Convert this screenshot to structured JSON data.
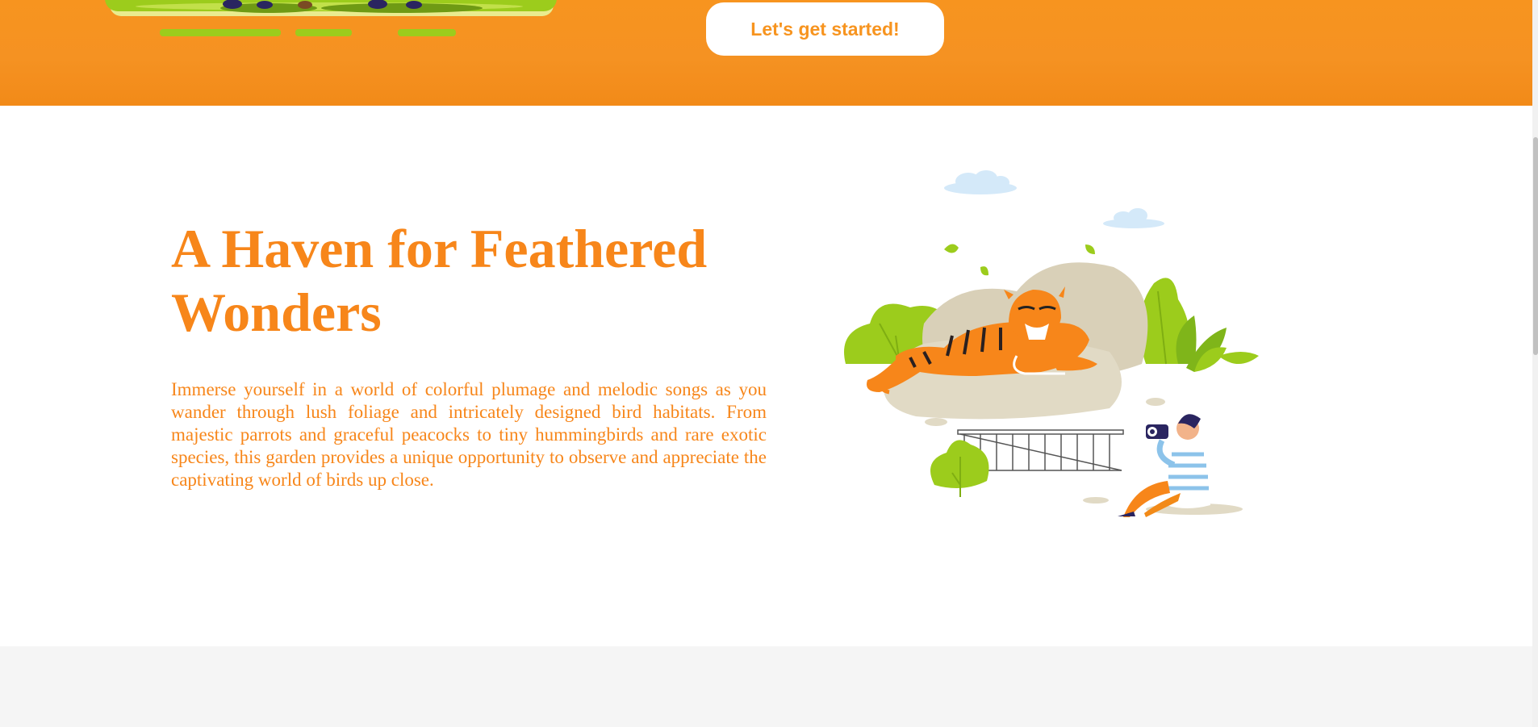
{
  "hero": {
    "cta_label": "Let's get started!"
  },
  "section": {
    "heading": "A Haven for Feathered Wonders",
    "paragraph": "Immerse yourself in a world of colorful plumage and melodic songs as you wander through lush foliage and intricately designed bird habitats. From majestic parrots and graceful peacocks to tiny hummingbirds and rare exotic species, this garden provides a unique opportunity to observe and appreciate the captivating world of birds up close."
  },
  "colors": {
    "brand_orange": "#f7941f",
    "heading_orange": "#f7861a",
    "leaf_green": "#9ccc1c",
    "rock_beige": "#d9d0b8",
    "sky_blue": "#cfe6f7",
    "footer_grey": "#f5f5f5"
  },
  "icons": {
    "hero_art": "zoo-visitors-illustration",
    "section_art": "tiger-photographer-illustration"
  }
}
